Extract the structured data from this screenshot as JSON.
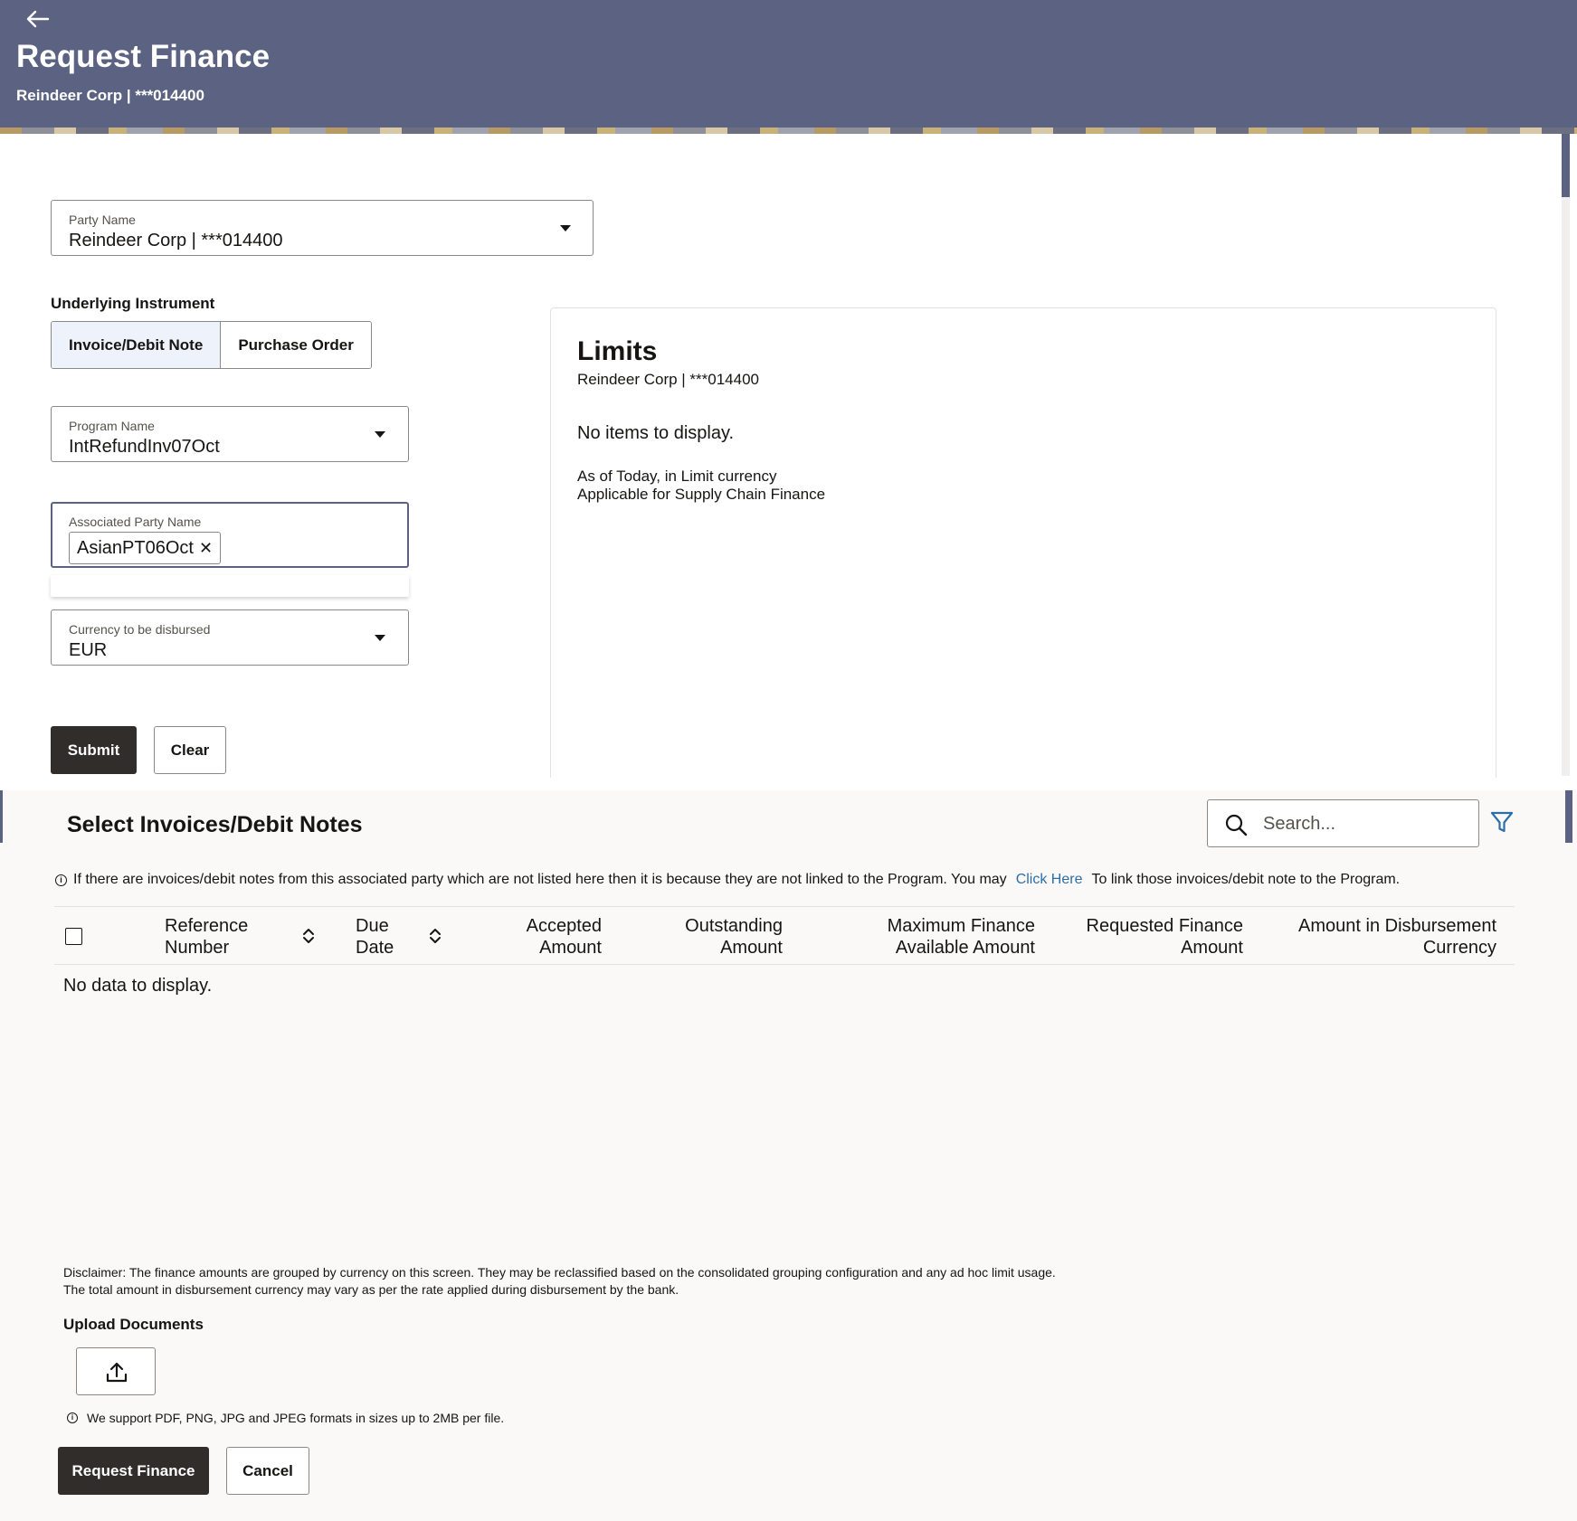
{
  "header": {
    "title": "Request Finance",
    "subtitle": "Reindeer Corp | ***014400"
  },
  "form": {
    "party_name": {
      "label": "Party Name",
      "value": "Reindeer Corp | ***014400"
    },
    "underlying_instrument": {
      "label": "Underlying Instrument",
      "options": [
        "Invoice/Debit Note",
        "Purchase Order"
      ],
      "selected": "Invoice/Debit Note"
    },
    "program_name": {
      "label": "Program Name",
      "value": "IntRefundInv07Oct"
    },
    "associated_party": {
      "label": "Associated Party Name",
      "chip": "AsianPT06Oct"
    },
    "currency": {
      "label": "Currency to be disbursed",
      "value": "EUR"
    },
    "submit_label": "Submit",
    "clear_label": "Clear"
  },
  "limits": {
    "title": "Limits",
    "subtitle": "Reindeer Corp | ***014400",
    "empty_message": "No items to display.",
    "note1": "As of Today, in Limit currency",
    "note2": "Applicable for Supply Chain Finance"
  },
  "invoices": {
    "title": "Select Invoices/Debit Notes",
    "search_placeholder": "Search...",
    "info_text": "If there are invoices/debit notes from this associated party which are not listed here then it is because they are not linked to the Program. You may",
    "info_link": "Click Here",
    "info_suffix": "To link those invoices/debit note to the Program.",
    "columns": [
      {
        "line1": "Reference",
        "line2": "Number"
      },
      {
        "line1": "Due",
        "line2": "Date"
      },
      {
        "line1": "Accepted",
        "line2": "Amount"
      },
      {
        "line1": "Outstanding",
        "line2": "Amount"
      },
      {
        "line1": "Maximum Finance",
        "line2": "Available Amount"
      },
      {
        "line1": "Requested Finance",
        "line2": "Amount"
      },
      {
        "line1": "Amount in Disbursement",
        "line2": "Currency"
      }
    ],
    "empty_message": "No data to display."
  },
  "footer": {
    "disclaimer_line1": "Disclaimer: The finance amounts are grouped by currency on this screen. They may be reclassified based on the consolidated grouping configuration and any ad hoc limit usage.",
    "disclaimer_line2": "The total amount in disbursement currency may vary as per the rate applied during disbursement by the bank.",
    "upload_label": "Upload Documents",
    "support_note": "We support PDF, PNG, JPG and JPEG formats in sizes up to 2MB per file.",
    "request_label": "Request Finance",
    "cancel_label": "Cancel"
  },
  "colors": {
    "header_bg": "#5b6282",
    "primary_button": "#312d2a",
    "link": "#2d6da8",
    "active_toggle": "#eef2fb"
  },
  "icons": [
    "back-arrow-icon",
    "chevron-down-icon",
    "close-icon",
    "search-icon",
    "filter-icon",
    "info-icon",
    "sort-icon",
    "upload-icon"
  ]
}
